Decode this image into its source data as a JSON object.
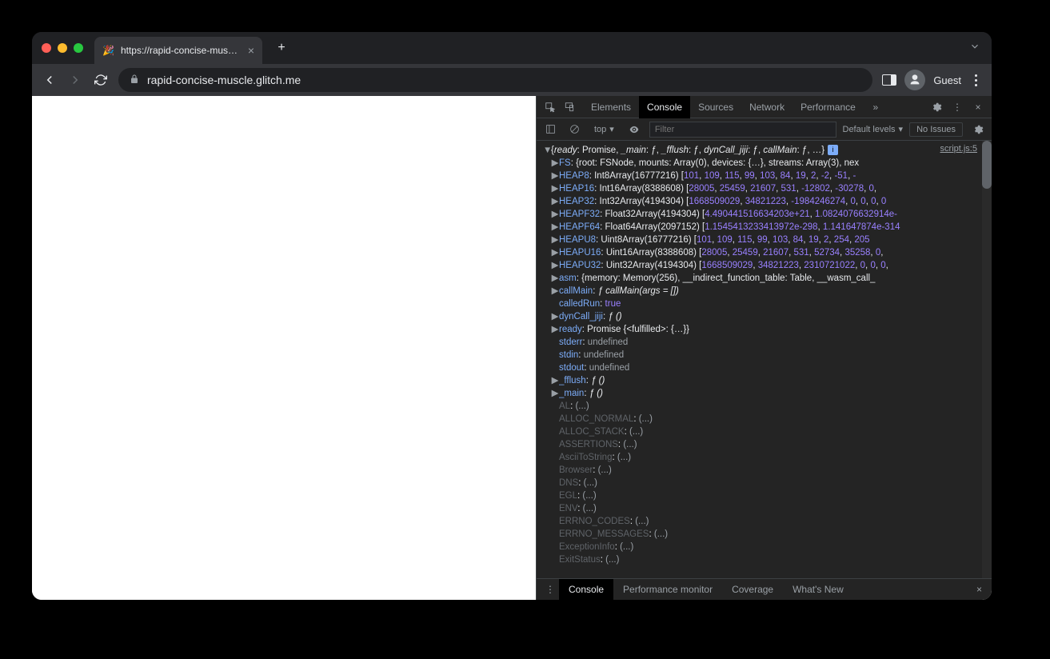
{
  "browser": {
    "tab_title": "https://rapid-concise-muscle.g",
    "url": "rapid-concise-muscle.glitch.me",
    "guest_label": "Guest"
  },
  "devtools": {
    "panels": [
      "Elements",
      "Console",
      "Sources",
      "Network",
      "Performance"
    ],
    "active_panel": "Console",
    "context": "top",
    "filter_placeholder": "Filter",
    "levels": "Default levels",
    "issues": "No Issues",
    "source_link": "script.js:5",
    "drawer_tabs": [
      "Console",
      "Performance monitor",
      "Coverage",
      "What's New"
    ],
    "drawer_active": "Console"
  },
  "console_object": {
    "summary_prefix": "{",
    "summary_parts": [
      {
        "k": "ready",
        "v": "Promise"
      },
      {
        "k": "_main",
        "v": "ƒ"
      },
      {
        "k": "_fflush",
        "v": "ƒ"
      },
      {
        "k": "dynCall_jiji",
        "v": "ƒ"
      },
      {
        "k": "callMain",
        "v": "ƒ"
      }
    ],
    "summary_suffix": ", …}",
    "rows": [
      {
        "tw": "▶",
        "kind": "obj",
        "key": "FS",
        "body": ": {root: FSNode, mounts: Array(0), devices: {…}, streams: Array(3), nex"
      },
      {
        "tw": "▶",
        "kind": "arr",
        "key": "HEAP8",
        "type": "Int8Array(16777216)",
        "nums": [
          "101",
          "109",
          "115",
          "99",
          "103",
          "84",
          "19",
          "2",
          "-2",
          "-51",
          "-"
        ]
      },
      {
        "tw": "▶",
        "kind": "arr",
        "key": "HEAP16",
        "type": "Int16Array(8388608)",
        "nums": [
          "28005",
          "25459",
          "21607",
          "531",
          "-12802",
          "-30278",
          "0",
          ""
        ]
      },
      {
        "tw": "▶",
        "kind": "arr",
        "key": "HEAP32",
        "type": "Int32Array(4194304)",
        "nums": [
          "1668509029",
          "34821223",
          "-1984246274",
          "0",
          "0",
          "0",
          "0"
        ]
      },
      {
        "tw": "▶",
        "kind": "arr",
        "key": "HEAPF32",
        "type": "Float32Array(4194304)",
        "nums": [
          "4.490441516634203e+21",
          "1.0824076632914e-"
        ]
      },
      {
        "tw": "▶",
        "kind": "arr",
        "key": "HEAPF64",
        "type": "Float64Array(2097152)",
        "nums": [
          "1.1545413233413972e-298",
          "1.141647874e-314"
        ]
      },
      {
        "tw": "▶",
        "kind": "arr",
        "key": "HEAPU8",
        "type": "Uint8Array(16777216)",
        "nums": [
          "101",
          "109",
          "115",
          "99",
          "103",
          "84",
          "19",
          "2",
          "254",
          "205"
        ]
      },
      {
        "tw": "▶",
        "kind": "arr",
        "key": "HEAPU16",
        "type": "Uint16Array(8388608)",
        "nums": [
          "28005",
          "25459",
          "21607",
          "531",
          "52734",
          "35258",
          "0",
          ""
        ]
      },
      {
        "tw": "▶",
        "kind": "arr",
        "key": "HEAPU32",
        "type": "Uint32Array(4194304)",
        "nums": [
          "1668509029",
          "34821223",
          "2310721022",
          "0",
          "0",
          "0",
          ""
        ]
      },
      {
        "tw": "▶",
        "kind": "obj",
        "key": "asm",
        "body": ": {memory: Memory(256), __indirect_function_table: Table, __wasm_call_"
      },
      {
        "tw": "▶",
        "kind": "fn",
        "key": "callMain",
        "sig": "ƒ callMain(args = [])"
      },
      {
        "tw": "",
        "kind": "bool",
        "key": "calledRun",
        "val": "true"
      },
      {
        "tw": "▶",
        "kind": "fn",
        "key": "dynCall_jiji",
        "sig": "ƒ ()"
      },
      {
        "tw": "▶",
        "kind": "prom",
        "key": "ready",
        "body": ": Promise {<fulfilled>: {…}}"
      },
      {
        "tw": "",
        "kind": "undef",
        "key": "stderr",
        "val": "undefined"
      },
      {
        "tw": "",
        "kind": "undef",
        "key": "stdin",
        "val": "undefined"
      },
      {
        "tw": "",
        "kind": "undef",
        "key": "stdout",
        "val": "undefined"
      },
      {
        "tw": "▶",
        "kind": "fn",
        "key": "_fflush",
        "sig": "ƒ ()"
      },
      {
        "tw": "▶",
        "kind": "fn",
        "key": "_main",
        "sig": "ƒ ()"
      },
      {
        "tw": "",
        "kind": "dim",
        "key": "AL",
        "val": "(...)"
      },
      {
        "tw": "",
        "kind": "dim",
        "key": "ALLOC_NORMAL",
        "val": "(...)"
      },
      {
        "tw": "",
        "kind": "dim",
        "key": "ALLOC_STACK",
        "val": "(...)"
      },
      {
        "tw": "",
        "kind": "dim",
        "key": "ASSERTIONS",
        "val": "(...)"
      },
      {
        "tw": "",
        "kind": "dim",
        "key": "AsciiToString",
        "val": "(...)"
      },
      {
        "tw": "",
        "kind": "dim",
        "key": "Browser",
        "val": "(...)"
      },
      {
        "tw": "",
        "kind": "dim",
        "key": "DNS",
        "val": "(...)"
      },
      {
        "tw": "",
        "kind": "dim",
        "key": "EGL",
        "val": "(...)"
      },
      {
        "tw": "",
        "kind": "dim",
        "key": "ENV",
        "val": "(...)"
      },
      {
        "tw": "",
        "kind": "dim",
        "key": "ERRNO_CODES",
        "val": "(...)"
      },
      {
        "tw": "",
        "kind": "dim",
        "key": "ERRNO_MESSAGES",
        "val": "(...)"
      },
      {
        "tw": "",
        "kind": "dim",
        "key": "ExceptionInfo",
        "val": "(...)"
      },
      {
        "tw": "",
        "kind": "dim",
        "key": "ExitStatus",
        "val": "(...)"
      }
    ]
  }
}
